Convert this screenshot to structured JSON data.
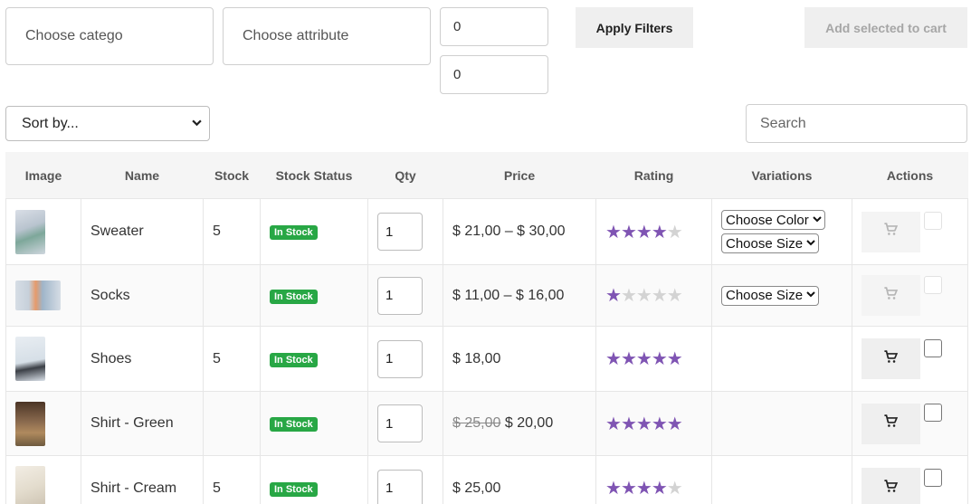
{
  "filters": {
    "category_placeholder": "Choose category",
    "attribute_placeholder": "Choose attribute",
    "min_value": "0",
    "max_value": "0",
    "apply_label": "Apply Filters",
    "add_selected_label": "Add selected to cart"
  },
  "sort": {
    "selected": "Sort by..."
  },
  "search": {
    "placeholder": "Search"
  },
  "table": {
    "headers": [
      "Image",
      "Name",
      "Stock",
      "Stock Status",
      "Qty",
      "Price",
      "Rating",
      "Variations",
      "Actions"
    ],
    "rows": [
      {
        "name": "Sweater",
        "stock": "5",
        "status": "In Stock",
        "qty": "1",
        "price": "$ 21,00 – $ 30,00",
        "old_price": "",
        "rating": 4,
        "variations": [
          "Choose Color",
          "Choose Size"
        ],
        "enabled": false
      },
      {
        "name": "Socks",
        "stock": "",
        "status": "In Stock",
        "qty": "1",
        "price": "$ 11,00 – $ 16,00",
        "old_price": "",
        "rating": 1,
        "variations": [
          "Choose Size"
        ],
        "enabled": false
      },
      {
        "name": "Shoes",
        "stock": "5",
        "status": "In Stock",
        "qty": "1",
        "price": "$ 18,00",
        "old_price": "",
        "rating": 5,
        "variations": [],
        "enabled": true
      },
      {
        "name": "Shirt - Green",
        "stock": "",
        "status": "In Stock",
        "qty": "1",
        "price": "$ 20,00",
        "old_price": "$ 25,00",
        "rating": 5,
        "variations": [],
        "enabled": true
      },
      {
        "name": "Shirt - Cream",
        "stock": "5",
        "status": "In Stock",
        "qty": "1",
        "price": "$ 25,00",
        "old_price": "",
        "rating": 4,
        "variations": [],
        "enabled": true
      }
    ]
  },
  "icons": {
    "cart": "cart-icon",
    "chevron": "chevron-down-icon"
  },
  "colors": {
    "star_on": "#7f54b3",
    "star_off": "#d3d3d3",
    "in_stock": "#28a745",
    "button_bg": "#efefef"
  }
}
